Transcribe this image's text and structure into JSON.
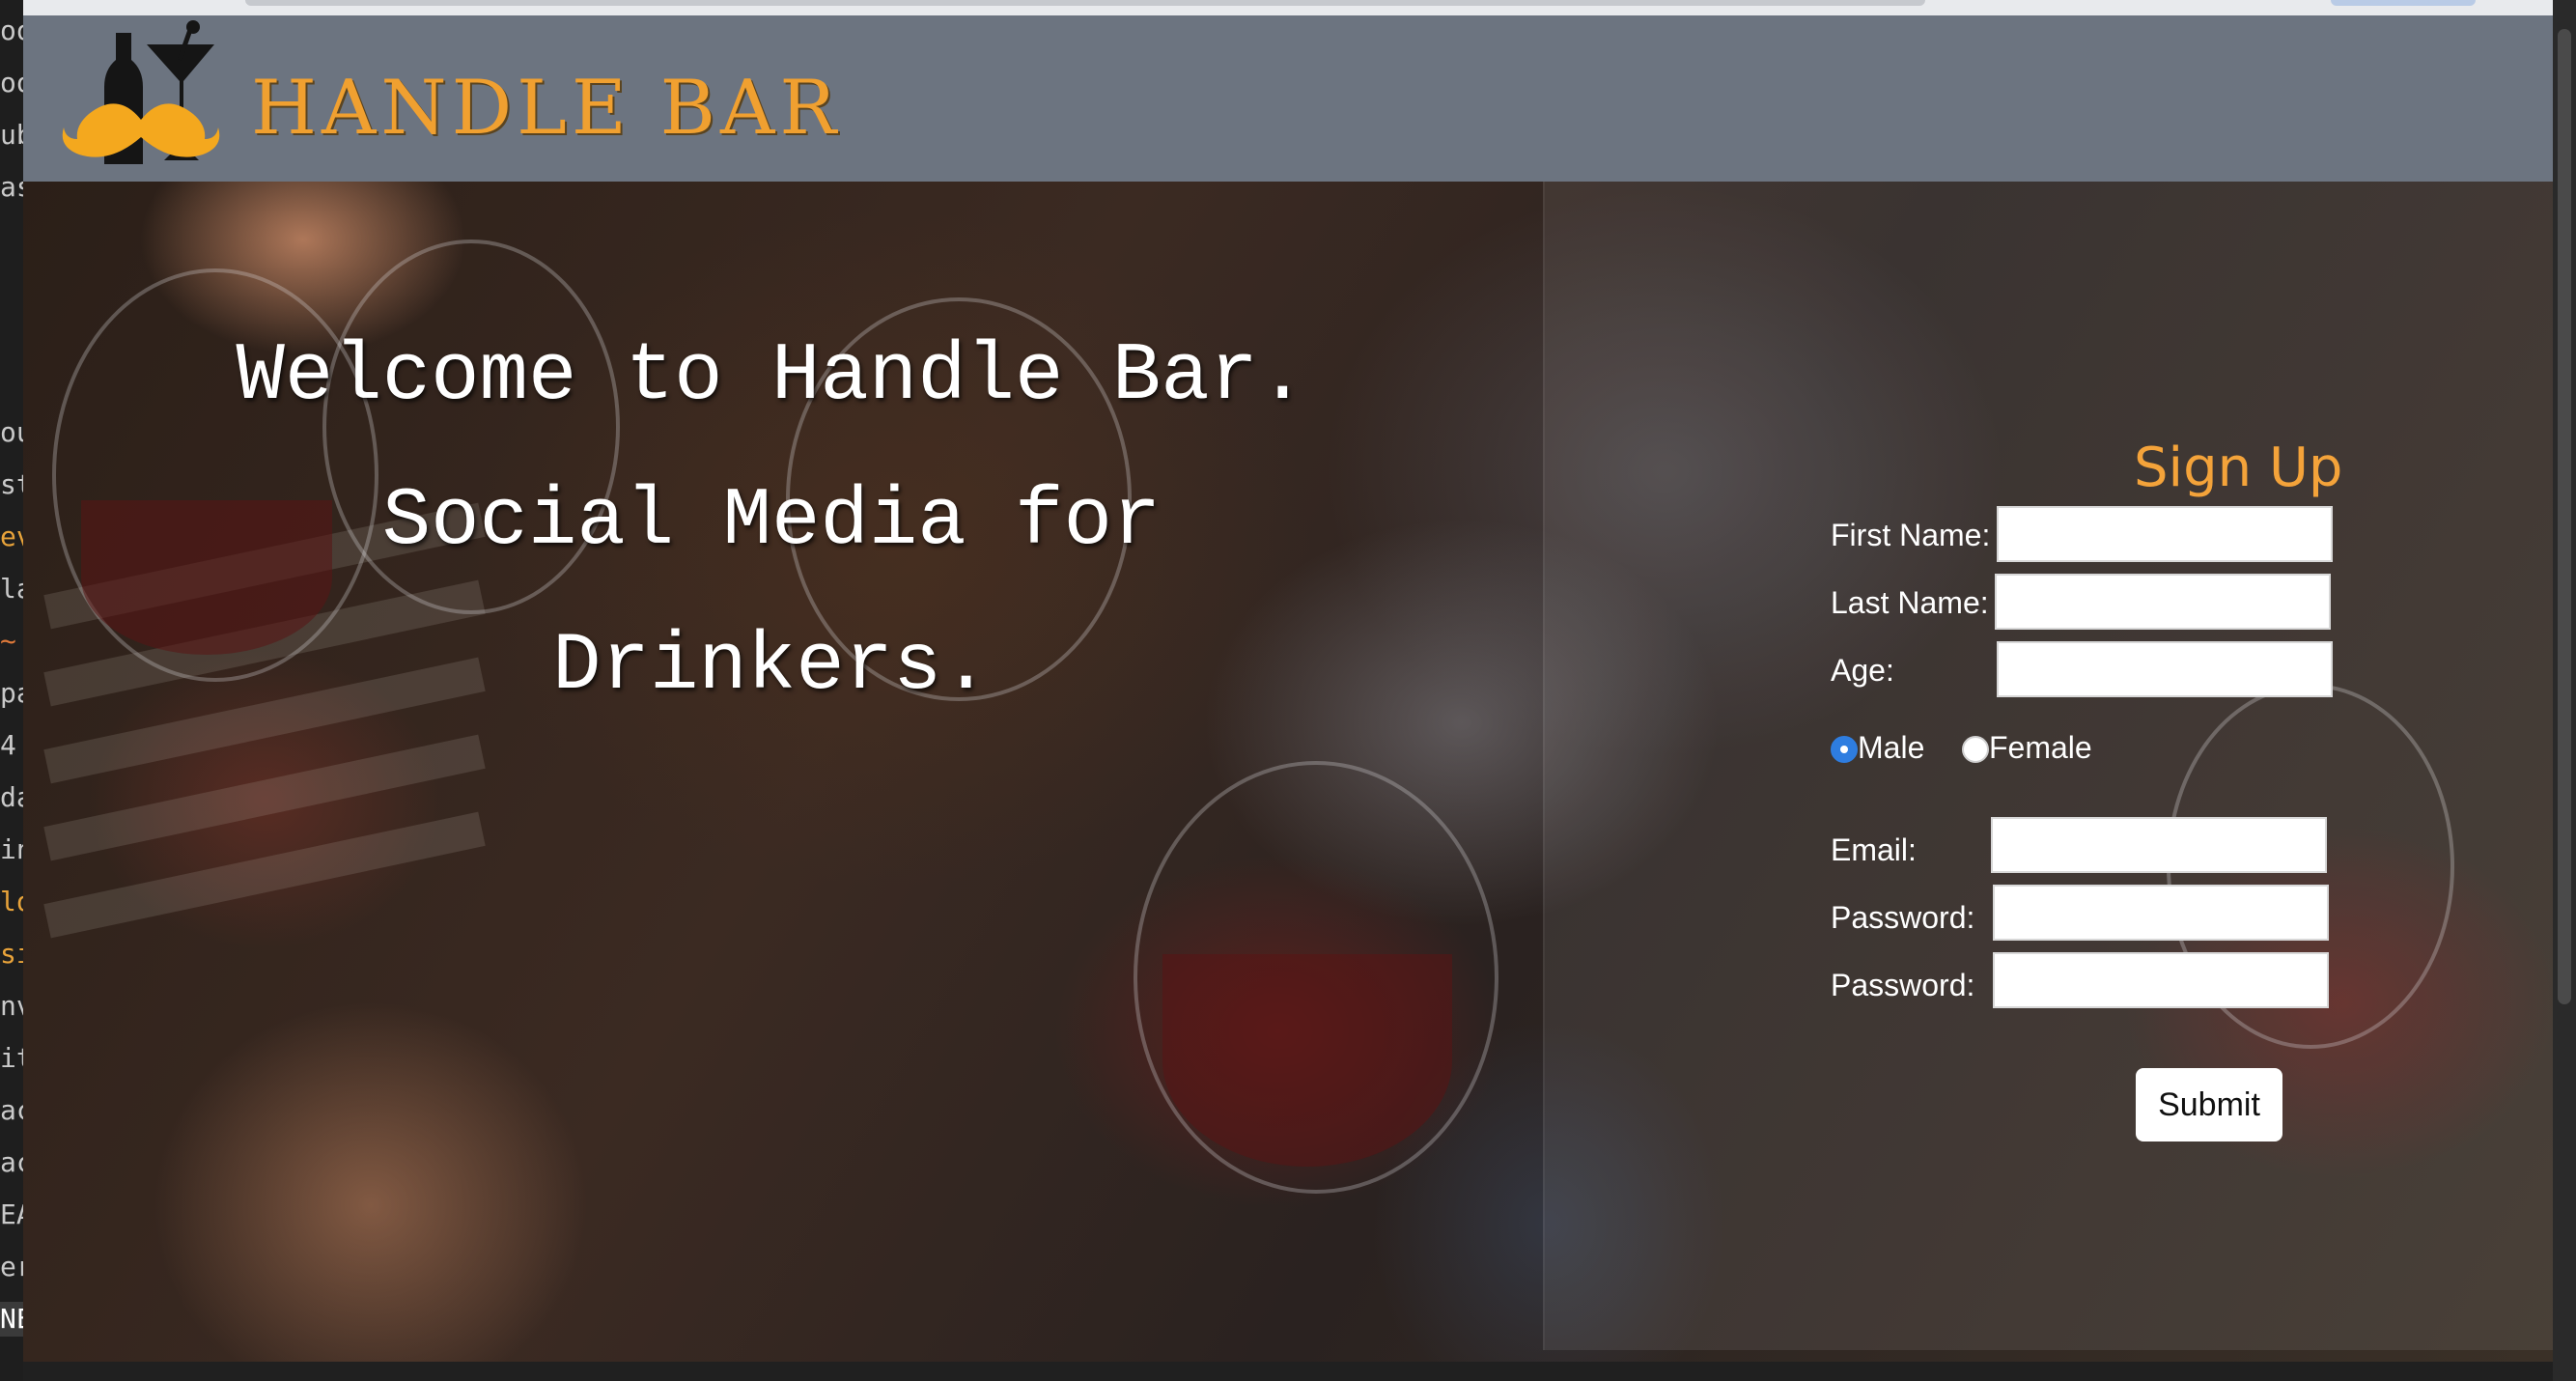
{
  "editor_fragments": [
    "oo",
    "oo",
    "ub",
    "as",
    "",
    "",
    "",
    "",
    "ou",
    "st",
    "ev",
    "la",
    "~",
    "pa",
    "4",
    "da",
    "in",
    "lo",
    "si",
    "nv",
    "iti",
    "ac",
    "ac",
    "EA",
    "er",
    "NE"
  ],
  "brand": {
    "name": "HANDLE BAR",
    "logo_icon": "mustache-bottle-cocktail-icon",
    "accent_color": "#f0a030"
  },
  "hero": {
    "lines": [
      "Welcome to Handle Bar.",
      "Social Media for",
      "Drinkers."
    ]
  },
  "signup": {
    "title": "Sign Up",
    "title_color": "#f4a33a",
    "fields": {
      "first_name": {
        "label": "First Name:",
        "value": ""
      },
      "last_name": {
        "label": "Last Name:",
        "value": ""
      },
      "age": {
        "label": "Age:",
        "value": ""
      },
      "email": {
        "label": "Email:",
        "value": ""
      },
      "password": {
        "label": "Password:",
        "value": ""
      },
      "password_confirm": {
        "label": "Password:",
        "value": ""
      }
    },
    "gender": {
      "options": [
        {
          "label": "Male",
          "checked": true
        },
        {
          "label": "Female",
          "checked": false
        }
      ],
      "selected_color": "#2e7de0"
    },
    "submit_label": "Submit"
  }
}
